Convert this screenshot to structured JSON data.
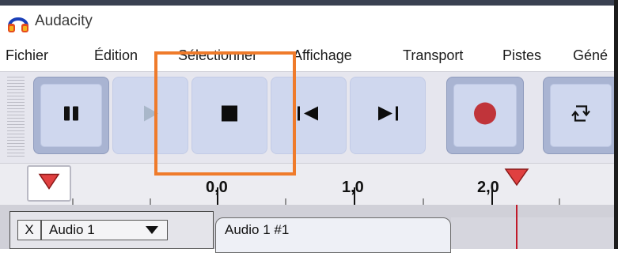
{
  "window": {
    "title": "Audacity",
    "icon": "headphones-icon"
  },
  "menu": [
    {
      "label": "Fichier"
    },
    {
      "label": "Édition"
    },
    {
      "label": "Sélectionner"
    },
    {
      "label": "Affichage"
    },
    {
      "label": "Transport"
    },
    {
      "label": "Pistes"
    },
    {
      "label": "Géné"
    }
  ],
  "toolbar": {
    "pause_icon": "pause-icon",
    "play_icon": "play-icon",
    "stop_icon": "stop-icon",
    "skip_start_icon": "skip-to-start-icon",
    "skip_end_icon": "skip-to-end-icon",
    "record_icon": "record-icon",
    "loop_icon": "loop-icon",
    "record_color": "#c0343a",
    "button_color": "#cfd7ee"
  },
  "ruler": {
    "labels": [
      "0,0",
      "1,0",
      "2,0"
    ],
    "marker_color": "#e04040"
  },
  "track": {
    "close_label": "X",
    "name": "Audio 1",
    "clip_name": "Audio 1 #1",
    "playhead_color": "#c01a2a"
  },
  "annotation": {
    "highlight_color": "#ef7b2b"
  }
}
